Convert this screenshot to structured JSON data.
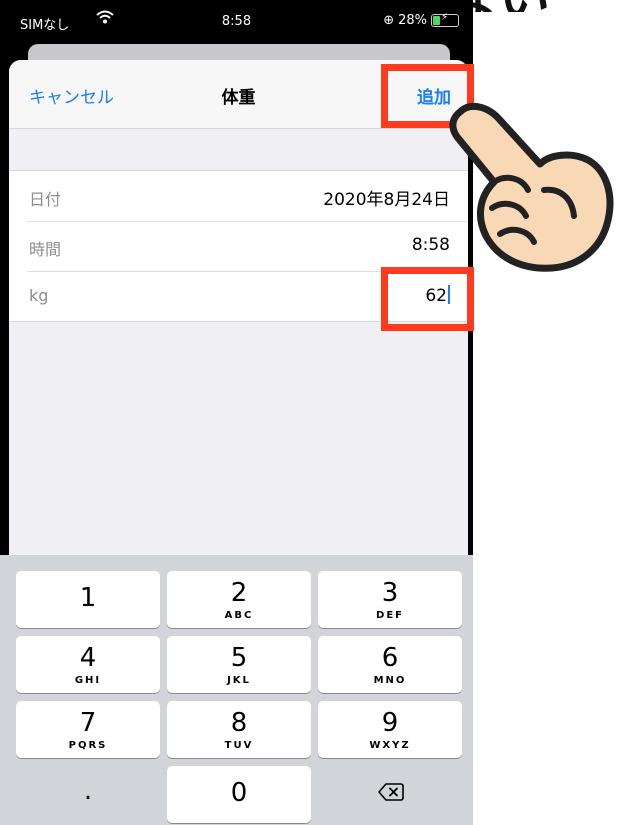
{
  "caption": {
    "text": "上半部分は見えない"
  },
  "status_bar": {
    "carrier": "SIMなし",
    "time": "8:58",
    "battery": "28%"
  },
  "nav": {
    "cancel_label": "キャンセル",
    "title": "体重",
    "add_label": "追加"
  },
  "form": {
    "rows": [
      {
        "label": "日付",
        "value": "2020年8月24日"
      },
      {
        "label": "時間",
        "value": "8:58"
      },
      {
        "label": "kg",
        "value": "62"
      }
    ]
  },
  "keypad": {
    "keys": [
      {
        "digit": "1",
        "letters": ""
      },
      {
        "digit": "2",
        "letters": "ABC"
      },
      {
        "digit": "3",
        "letters": "DEF"
      },
      {
        "digit": "4",
        "letters": "GHI"
      },
      {
        "digit": "5",
        "letters": "JKL"
      },
      {
        "digit": "6",
        "letters": "MNO"
      },
      {
        "digit": "7",
        "letters": "PQRS"
      },
      {
        "digit": "8",
        "letters": "TUV"
      },
      {
        "digit": "9",
        "letters": "WXYZ"
      },
      {
        "digit": ".",
        "letters": ""
      },
      {
        "digit": "0",
        "letters": ""
      }
    ],
    "backspace_icon": "backspace-icon"
  },
  "colors": {
    "accent": "#1a7cff",
    "highlight": "#ff3b1f",
    "hand_skin": "#f9d8b6"
  },
  "icons": [
    "wifi-icon",
    "battery-icon",
    "backspace-icon",
    "pointing-hand-icon"
  ]
}
